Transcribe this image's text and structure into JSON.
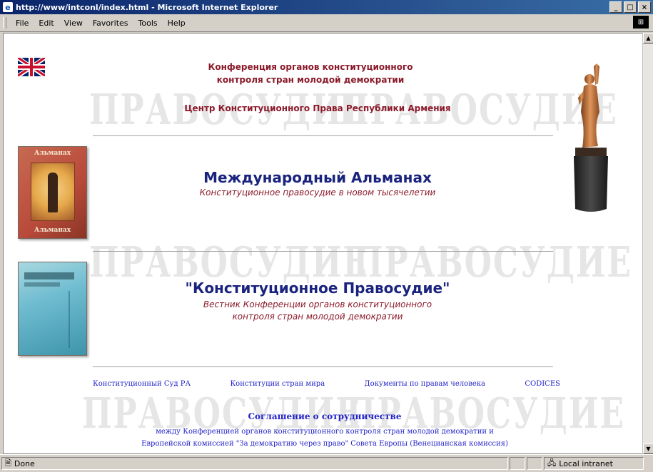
{
  "window": {
    "title": "http://www/intconl/index.html - Microsoft Internet Explorer",
    "controls": [
      "_",
      "□",
      "×"
    ]
  },
  "menu": [
    "File",
    "Edit",
    "View",
    "Favorites",
    "Tools",
    "Help"
  ],
  "page": {
    "watermark": "ПРАВОСУДИЕ",
    "header_line1": "Конференция органов конституционного",
    "header_line2": "контроля стран молодой демократии",
    "center_name": "Центр Конституционного Права Республики Армения",
    "almanac_title": "Международный Альманах",
    "almanac_subtitle": "Конституционное правосудие в новом тысячелетии",
    "book1_label": "Альманах",
    "journal_title": "\"Конституционное Правосудие\"",
    "journal_sub1": "Вестник Конференции органов конституционного",
    "journal_sub2": "контроля стран молодой демократии",
    "links": [
      "Конституционный Суд РА",
      "Конституции стран мира",
      "Документы по правам человека",
      "CODICES"
    ],
    "agreement_title": "Соглашение о сотрудничестве",
    "agreement_line1": "между Конференцией органов конституционного контроля стран молодой демократии и",
    "agreement_line2": "Европейской комиссией \"За демократию через право\" Совета Европы (Венецианская комиссия)"
  },
  "status": {
    "left": "Done",
    "zone": "Local intranet"
  }
}
